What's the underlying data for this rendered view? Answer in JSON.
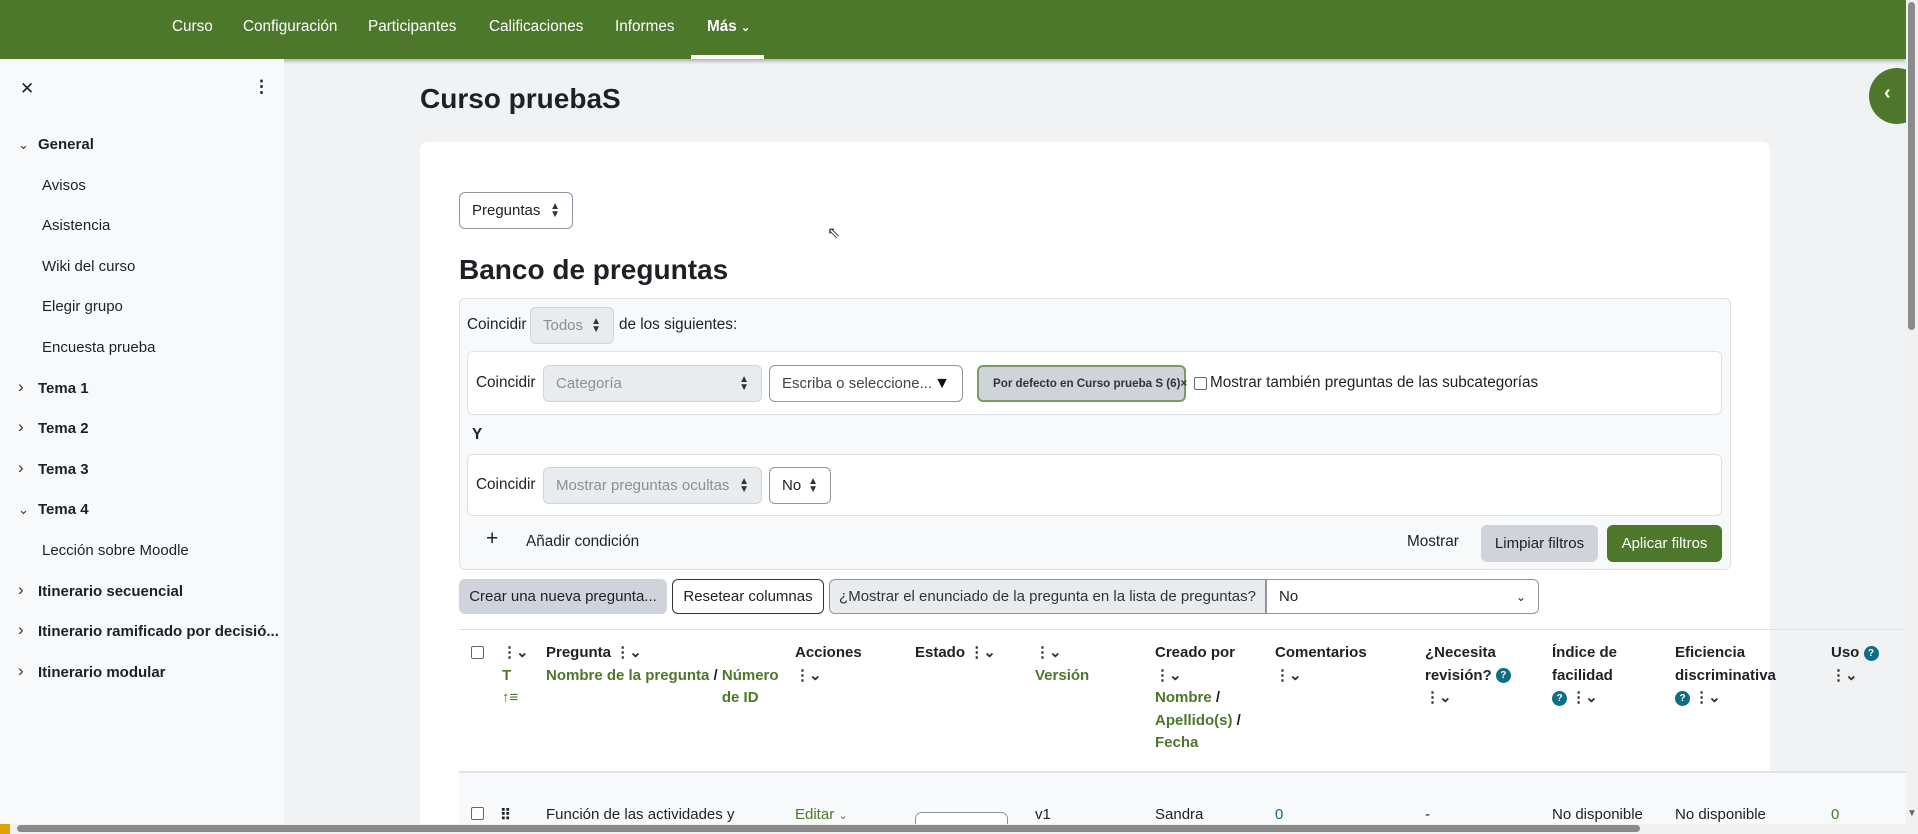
{
  "nav": {
    "items": [
      "Curso",
      "Configuración",
      "Participantes",
      "Calificaciones",
      "Informes"
    ],
    "more": "Más",
    "accent": "#4d772b"
  },
  "sidebar": {
    "items": [
      {
        "label": "General",
        "bold": true,
        "chevron": "down"
      },
      {
        "label": "Avisos"
      },
      {
        "label": "Asistencia"
      },
      {
        "label": "Wiki del curso"
      },
      {
        "label": "Elegir grupo"
      },
      {
        "label": "Encuesta prueba"
      },
      {
        "label": "Tema 1",
        "bold": true,
        "chevron": "right"
      },
      {
        "label": "Tema 2",
        "bold": true,
        "chevron": "right"
      },
      {
        "label": "Tema 3",
        "bold": true,
        "chevron": "right"
      },
      {
        "label": "Tema 4",
        "bold": true,
        "chevron": "down"
      },
      {
        "label": "Lección sobre Moodle"
      },
      {
        "label": "Itinerario secuencial",
        "bold": true,
        "chevron": "right"
      },
      {
        "label": "Itinerario ramificado por decisió...",
        "bold": true,
        "chevron": "right"
      },
      {
        "label": "Itinerario modular",
        "bold": true,
        "chevron": "right"
      }
    ]
  },
  "page": {
    "course_title": "Curso pruebaS",
    "section_select": "Preguntas",
    "heading": "Banco de preguntas"
  },
  "filters": {
    "match_label": "Coincidir",
    "match_value": "Todos",
    "of_following": "de los siguientes:",
    "category_type": "Categoría",
    "category_placeholder": "Escriba o seleccione...",
    "category_chip": "Por defecto en Curso prueba S (6)",
    "chip_remove": "×",
    "subcategories_label": "Mostrar también preguntas de las subcategorías",
    "subcategories_checked": false,
    "and_label": "Y",
    "hidden_type": "Mostrar preguntas ocultas",
    "hidden_value": "No",
    "add_condition": "Añadir condición",
    "show": "Mostrar",
    "clear": "Limpiar filtros",
    "apply": "Aplicar filtros"
  },
  "toolbar": {
    "create": "Crear una nueva pregunta...",
    "reset_columns": "Resetear columnas",
    "show_text_label": "¿Mostrar el enunciado de la pregunta en la lista de preguntas?",
    "show_text_value": "No"
  },
  "table": {
    "headers": {
      "type": "T",
      "question": "Pregunta",
      "question_sub1": "Nombre de la pregunta",
      "question_sub2": "Número de ID",
      "actions": "Acciones",
      "status": "Estado",
      "version": "Versión",
      "created_by": "Creado por",
      "created_sub1": "Nombre",
      "created_sub2": "Apellido(s)",
      "created_sub3": "Fecha",
      "comments": "Comentarios",
      "needs_review": "¿Necesita revisión?",
      "facility": "Índice de facilidad",
      "discrimination": "Eficiencia discriminativa",
      "usage": "Uso"
    },
    "rows": [
      {
        "question": "Función de las actividades y",
        "actions": "Editar",
        "version": "v1",
        "created_by": "Sandra",
        "comments": "0",
        "needs_review": "-",
        "facility": "No disponible",
        "discrimination": "No disponible",
        "usage": "0"
      }
    ]
  }
}
